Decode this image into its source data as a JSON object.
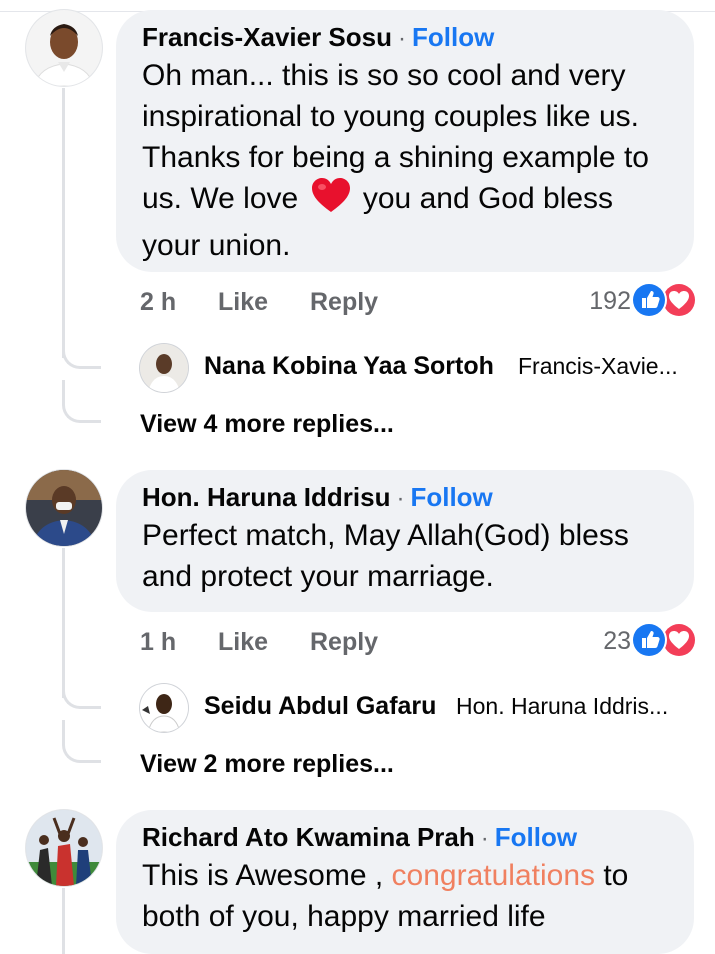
{
  "comments": [
    {
      "author": "Francis-Xavier Sosu",
      "follow": "Follow",
      "text_before_heart": "Oh man... this is so so cool and very inspirational to young couples like us. Thanks for being a shining example to us. We love",
      "text_after_heart": "you and God bless your union.",
      "time": "2 h",
      "like": "Like",
      "reply": "Reply",
      "reaction_count": "192",
      "reply_preview": {
        "author": "Nana Kobina Yaa Sortoh",
        "snippet": "Francis-Xavie..."
      },
      "more_replies": "View 4 more replies..."
    },
    {
      "author": "Hon. Haruna Iddrisu",
      "follow": "Follow",
      "text": "Perfect match, May Allah(God) bless and protect your marriage.",
      "time": "1 h",
      "like": "Like",
      "reply": "Reply",
      "reaction_count": "23",
      "reply_preview": {
        "author": "Seidu Abdul Gafaru",
        "snippet": "Hon. Haruna Iddris..."
      },
      "more_replies": "View 2 more replies..."
    },
    {
      "author": "Richard Ato Kwamina Prah",
      "follow": "Follow",
      "text_before_highlight": "This is Awesome , ",
      "highlight": "congratulations",
      "text_after_highlight": " to both of you, happy married life"
    }
  ],
  "colors": {
    "bubble": "#f0f2f5",
    "follow": "#1877f2",
    "like_reaction": "#1877f2",
    "love_reaction": "#f33e58",
    "highlight": "#f08060",
    "meta": "#65676b"
  },
  "icons": [
    "like-reaction-icon",
    "love-reaction-icon",
    "heart-emoji-icon"
  ]
}
